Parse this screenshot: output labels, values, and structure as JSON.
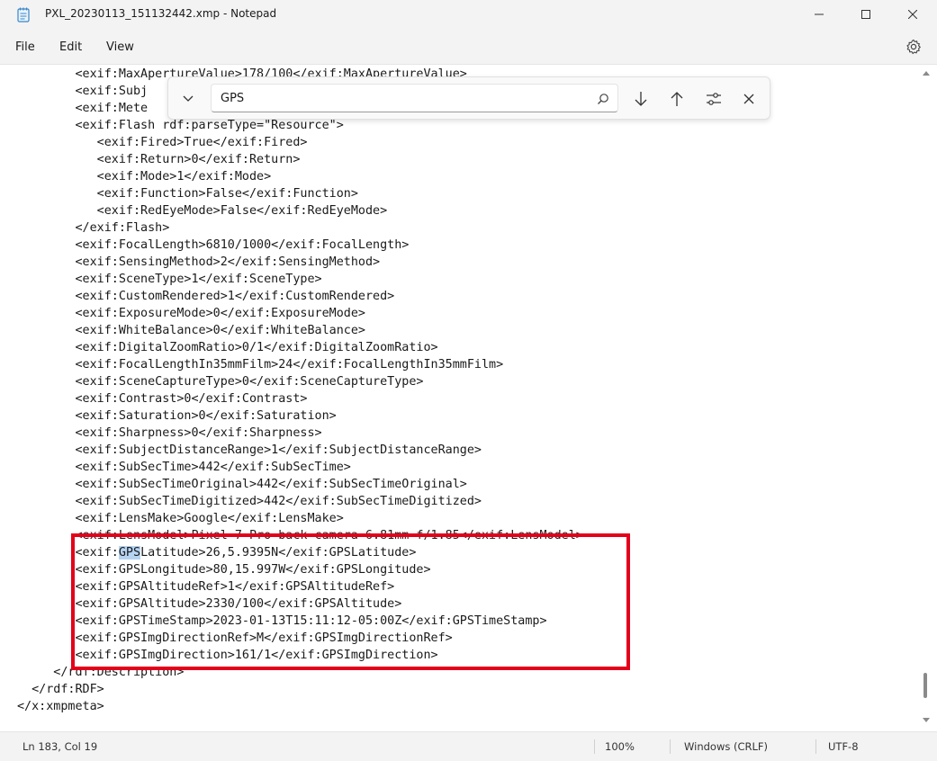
{
  "window": {
    "title": "PXL_20230113_151132442.xmp - Notepad"
  },
  "menu": {
    "file": "File",
    "edit": "Edit",
    "view": "View"
  },
  "find": {
    "value": "GPS",
    "icons": [
      "chevron-down-icon",
      "search-icon",
      "arrow-down-icon",
      "arrow-up-icon",
      "options-icon",
      "close-icon"
    ]
  },
  "editor": {
    "lines": [
      "        <exif:MaxApertureValue>178/100</exif:MaxApertureValue>",
      "        <exif:Subj",
      "        <exif:Mete",
      "        <exif:Flash rdf:parseType=\"Resource\">",
      "           <exif:Fired>True</exif:Fired>",
      "           <exif:Return>0</exif:Return>",
      "           <exif:Mode>1</exif:Mode>",
      "           <exif:Function>False</exif:Function>",
      "           <exif:RedEyeMode>False</exif:RedEyeMode>",
      "        </exif:Flash>",
      "        <exif:FocalLength>6810/1000</exif:FocalLength>",
      "        <exif:SensingMethod>2</exif:SensingMethod>",
      "        <exif:SceneType>1</exif:SceneType>",
      "        <exif:CustomRendered>1</exif:CustomRendered>",
      "        <exif:ExposureMode>0</exif:ExposureMode>",
      "        <exif:WhiteBalance>0</exif:WhiteBalance>",
      "        <exif:DigitalZoomRatio>0/1</exif:DigitalZoomRatio>",
      "        <exif:FocalLengthIn35mmFilm>24</exif:FocalLengthIn35mmFilm>",
      "        <exif:SceneCaptureType>0</exif:SceneCaptureType>",
      "        <exif:Contrast>0</exif:Contrast>",
      "        <exif:Saturation>0</exif:Saturation>",
      "        <exif:Sharpness>0</exif:Sharpness>",
      "        <exif:SubjectDistanceRange>1</exif:SubjectDistanceRange>",
      "        <exif:SubSecTime>442</exif:SubSecTime>",
      "        <exif:SubSecTimeOriginal>442</exif:SubSecTimeOriginal>",
      "        <exif:SubSecTimeDigitized>442</exif:SubSecTimeDigitized>",
      "        <exif:LensMake>Google</exif:LensMake>",
      "        <exif:LensModel>Pixel 7 Pro back camera 6.81mm f/1.85</exif:LensModel>",
      "        <exif:",
      "        <exif:GPSLongitude>80,15.997W</exif:GPSLongitude>",
      "        <exif:GPSAltitudeRef>1</exif:GPSAltitudeRef>",
      "        <exif:GPSAltitude>2330/100</exif:GPSAltitude>",
      "        <exif:GPSTimeStamp>2023-01-13T15:11:12-05:00Z</exif:GPSTimeStamp>",
      "        <exif:GPSImgDirectionRef>M</exif:GPSImgDirectionRef>",
      "        <exif:GPSImgDirection>161/1</exif:GPSImgDirection>",
      "     </rdf:Description>",
      "  </rdf:RDF>",
      "</x:xmpmeta>"
    ],
    "match_text": "GPS",
    "match_rest": "Latitude>26,5.9395N</exif:GPSLatitude>"
  },
  "status": {
    "position": "Ln 183, Col 19",
    "zoom": "100%",
    "line_ending": "Windows (CRLF)",
    "encoding": "UTF-8"
  },
  "colors": {
    "highlight_box": "#e3001b",
    "match_highlight": "#b6d4f2"
  }
}
